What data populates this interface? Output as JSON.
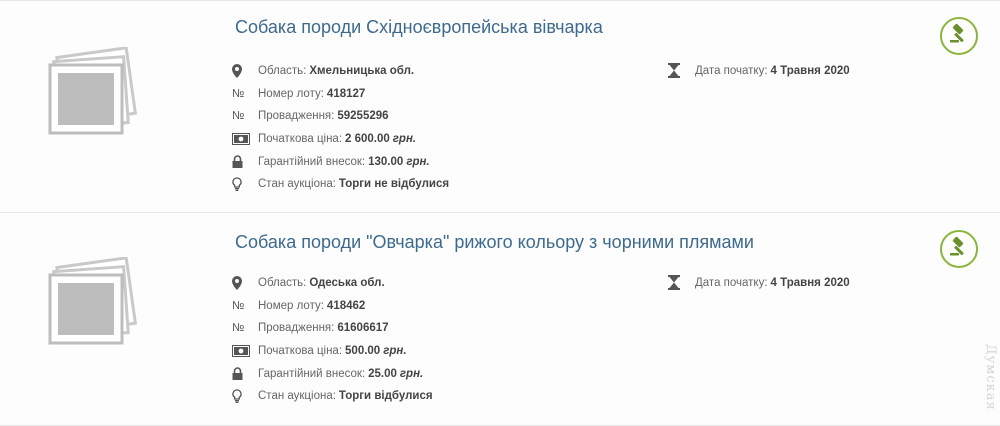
{
  "listings": [
    {
      "title": "Собака породи Східноєвропейська вівчарка",
      "region_label": "Область:",
      "region": "Хмельницька обл.",
      "lot_label": "Номер лоту:",
      "lot": "418127",
      "case_label": "Провадження:",
      "case": "59255296",
      "price_label": "Початкова ціна:",
      "price": "2 600.00",
      "price_currency": "грн.",
      "deposit_label": "Гарантійний внесок:",
      "deposit": "130.00",
      "deposit_currency": "грн.",
      "status_label": "Стан аукціона:",
      "status": "Торги не відбулися",
      "start_label": "Дата початку:",
      "start_date": "4 Травня 2020"
    },
    {
      "title": "Собака породи \"Овчарка\" рижого кольору з чорними плямами",
      "region_label": "Область:",
      "region": "Одеська обл.",
      "lot_label": "Номер лоту:",
      "lot": "418462",
      "case_label": "Провадження:",
      "case": "61606617",
      "price_label": "Початкова ціна:",
      "price": "500.00",
      "price_currency": "грн.",
      "deposit_label": "Гарантійний внесок:",
      "deposit": "25.00",
      "deposit_currency": "грн.",
      "status_label": "Стан аукціона:",
      "status": "Торги відбулися",
      "start_label": "Дата початку:",
      "start_date": "4 Травня 2020"
    }
  ],
  "icons": {
    "region": "map-marker-icon",
    "lot": "numero-sign-icon",
    "case": "numero-sign-icon",
    "price": "banknote-icon",
    "deposit": "lock-icon",
    "status": "lightbulb-icon",
    "start": "hourglass-icon",
    "bid": "gavel-icon",
    "thumb": "photo-placeholder-icon"
  },
  "numero_glyph": "№",
  "colors": {
    "title": "#3d6a8e",
    "bid_accent": "#8bb43b",
    "text": "#666666",
    "value": "#444444"
  },
  "watermark": "Думская"
}
